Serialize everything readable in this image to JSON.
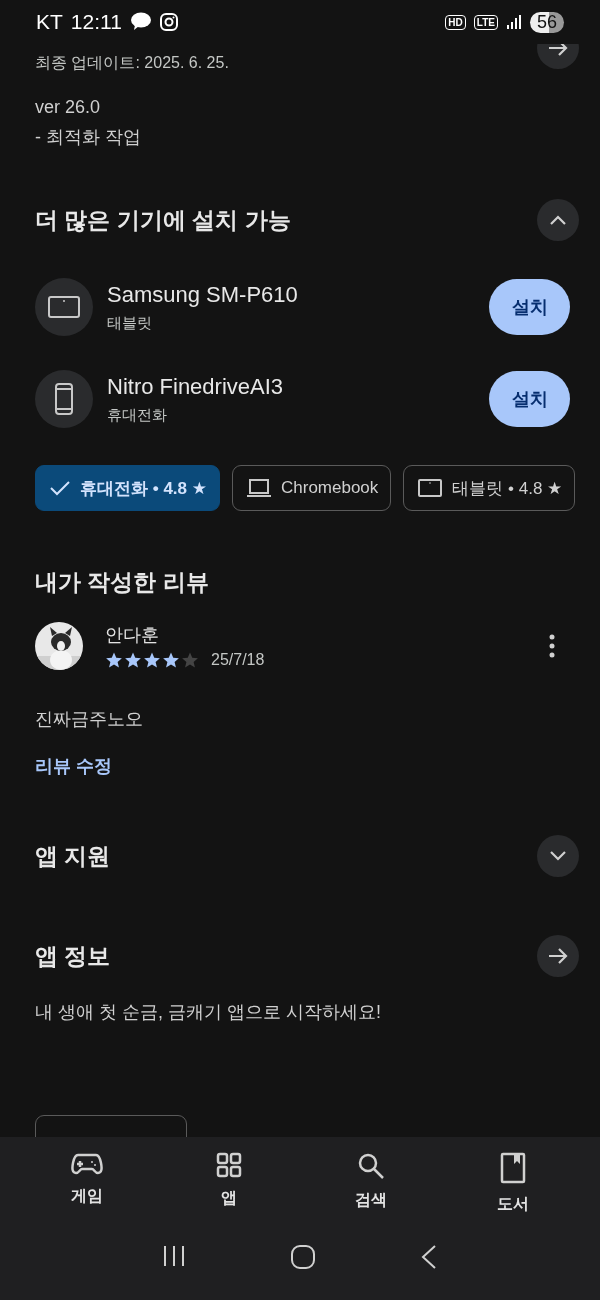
{
  "status_bar": {
    "carrier": "KT",
    "time": "12:11",
    "indicators": [
      "HD",
      "LTE"
    ],
    "battery": "56"
  },
  "update": {
    "last_updated": "최종 업데이트: 2025. 6. 25.",
    "version": "ver 26.0",
    "notes": "- 최적화 작업"
  },
  "devices_section": {
    "title": "더 많은 기기에 설치 가능",
    "expanded": true,
    "devices": [
      {
        "kind": "tablet",
        "name": "Samsung SM-P610",
        "type": "태블릿",
        "button": "설치"
      },
      {
        "kind": "phone",
        "name": "Nitro FinedriveAI3",
        "type": "휴대전화",
        "button": "설치"
      }
    ]
  },
  "device_chips": [
    {
      "label": "휴대전화 • 4.8 ★",
      "selected": true
    },
    {
      "kind": "laptop",
      "label": "Chromebook",
      "selected": false
    },
    {
      "kind": "tablet",
      "label": "태블릿 • 4.8 ★",
      "selected": false
    }
  ],
  "my_review": {
    "title": "내가 작성한 리뷰",
    "author": "안다훈",
    "stars": 4,
    "date": "25/7/18",
    "text": "진짜금주노오",
    "edit_link": "리뷰 수정"
  },
  "app_support": {
    "title": "앱 지원",
    "expanded": false
  },
  "app_info": {
    "title": "앱 정보",
    "description": "내 생애 첫 순금, 금캐기 앱으로 시작하세요!"
  },
  "bottom_nav": [
    {
      "kind": "games",
      "label": "게임"
    },
    {
      "kind": "apps",
      "label": "앱"
    },
    {
      "kind": "search",
      "label": "검색"
    },
    {
      "kind": "books",
      "label": "도서"
    }
  ]
}
